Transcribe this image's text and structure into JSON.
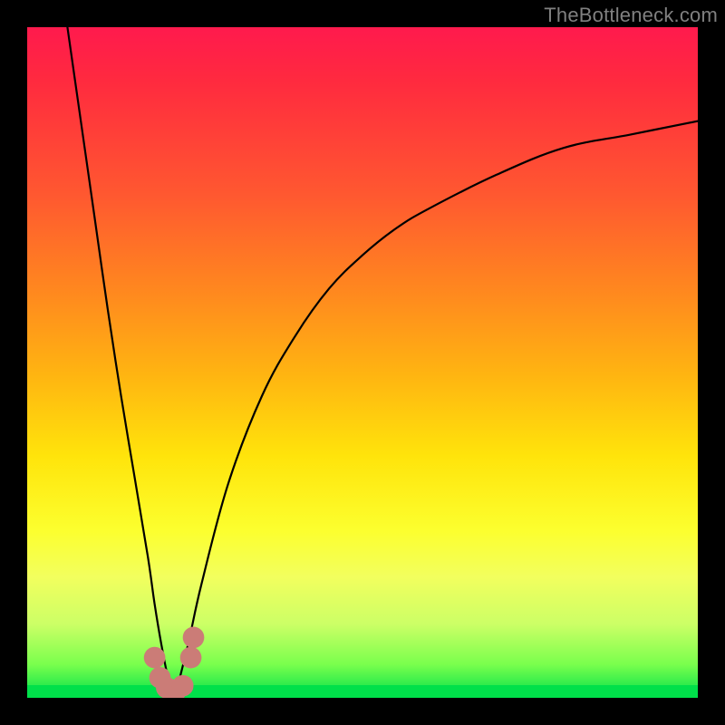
{
  "attribution": "TheBottleneck.com",
  "colors": {
    "gradient_top": "#ff1a4d",
    "gradient_bottom": "#00e04a",
    "curve": "#000000",
    "marker": "#cb7c77",
    "frame": "#000000",
    "attribution_text": "#808080"
  },
  "chart_data": {
    "type": "line",
    "title": "",
    "xlabel": "",
    "ylabel": "",
    "xlim": [
      0,
      100
    ],
    "ylim": [
      0,
      100
    ],
    "grid": false,
    "legend": false,
    "note": "Bottleneck-style V curve. x ≈ relative GPU/CPU balance (%), y ≈ bottleneck (%). Minimum ~0% near x≈22; both branches rise steeply away from the minimum; right branch asymptotes near y≈85–90% at x=100.",
    "series": [
      {
        "name": "left-branch",
        "x": [
          6,
          8,
          10,
          12,
          14,
          16,
          18,
          19,
          20,
          21,
          22
        ],
        "y": [
          100,
          86,
          72,
          58,
          45,
          33,
          21,
          14,
          8,
          3,
          0
        ]
      },
      {
        "name": "right-branch",
        "x": [
          22,
          24,
          26,
          30,
          35,
          40,
          45,
          50,
          55,
          60,
          70,
          80,
          90,
          100
        ],
        "y": [
          0,
          8,
          17,
          32,
          45,
          54,
          61,
          66,
          70,
          73,
          78,
          82,
          84,
          86
        ]
      }
    ],
    "markers": {
      "name": "near-minimum-cluster",
      "points": [
        {
          "x": 19.0,
          "y": 6
        },
        {
          "x": 19.8,
          "y": 3
        },
        {
          "x": 20.8,
          "y": 1.5
        },
        {
          "x": 22.0,
          "y": 0.8
        },
        {
          "x": 23.2,
          "y": 1.8
        },
        {
          "x": 24.4,
          "y": 6
        },
        {
          "x": 24.8,
          "y": 9
        }
      ],
      "radius_pct": 1.6
    }
  }
}
